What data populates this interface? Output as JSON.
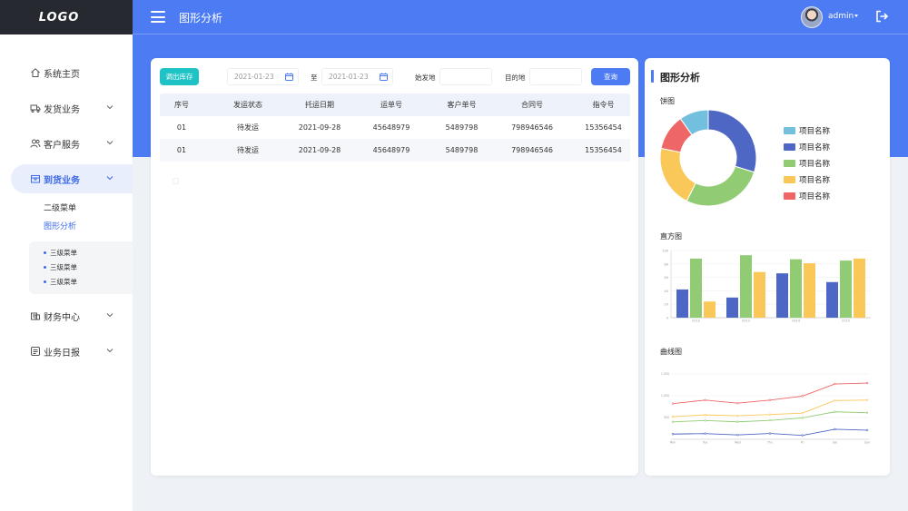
{
  "sidebar": {
    "logo": "LOGO",
    "items": [
      {
        "label": "系统主页",
        "icon": "home-icon"
      },
      {
        "label": "发货业务",
        "icon": "truck-icon"
      },
      {
        "label": "客户服务",
        "icon": "users-icon"
      },
      {
        "label": "到货业务",
        "icon": "box-icon"
      },
      {
        "label": "财务中心",
        "icon": "finance-icon"
      },
      {
        "label": "业务日报",
        "icon": "report-icon"
      }
    ],
    "submenu": [
      "二级菜单",
      "图形分析"
    ],
    "submenu2": [
      "三级菜单",
      "三级菜单",
      "三级菜单"
    ]
  },
  "header": {
    "title": "图形分析",
    "username": "admin"
  },
  "filter": {
    "export_label": "调出库存",
    "date_start": "2021-01-23",
    "date_sep": "至",
    "date_end": "2021-01-23",
    "origin_label": "始发地",
    "dest_label": "目的地",
    "query_label": "查询"
  },
  "table": {
    "columns": [
      "序号",
      "发运状态",
      "托运日期",
      "运单号",
      "客户单号",
      "合同号",
      "指令号"
    ],
    "rows": [
      [
        "01",
        "待发运",
        "2021-09-28",
        "45648979",
        "5489798",
        "798946546",
        "15356454"
      ],
      [
        "01",
        "待发运",
        "2021-09-28",
        "45648979",
        "5489798",
        "798946546",
        "15356454"
      ]
    ]
  },
  "analysis": {
    "title": "图形分析",
    "pie_title": "饼图",
    "bar_title": "直方图",
    "line_title": "曲线图"
  },
  "colors": {
    "accent": "#4c7bf3",
    "teal": "#1fc3c6"
  },
  "chart_data": [
    {
      "type": "pie",
      "title": "饼图",
      "categories": [
        "项目名称",
        "项目名称",
        "项目名称",
        "项目名称",
        "项目名称"
      ],
      "values": [
        335,
        310,
        234,
        135,
        110
      ],
      "colors": [
        "#4e66c4",
        "#91cc75",
        "#fac858",
        "#ee6666",
        "#73c0de"
      ],
      "legend_order": [
        4,
        0,
        1,
        2,
        3
      ],
      "donut": true,
      "legend": "right"
    },
    {
      "type": "bar",
      "title": "直方图",
      "categories": [
        "2012",
        "2013",
        "2014",
        "2015"
      ],
      "ylim": [
        0,
        100
      ],
      "yticks": [
        "100",
        "80",
        "60",
        "40",
        "20",
        "0"
      ],
      "series": [
        {
          "values": [
            42,
            30,
            66,
            53
          ],
          "color": "#4e66c4"
        },
        {
          "values": [
            88,
            93,
            87,
            85
          ],
          "color": "#91cc75"
        },
        {
          "values": [
            24,
            68,
            81,
            88
          ],
          "color": "#fac858"
        }
      ]
    },
    {
      "type": "line",
      "title": "曲线图",
      "categories": [
        "Mon",
        "Tue",
        "Wed",
        "Thu",
        "Fri",
        "Sat",
        "Sun"
      ],
      "ylim": [
        0,
        1500
      ],
      "yticks": [
        "1,500",
        "1,000",
        "500"
      ],
      "series": [
        {
          "values": [
            120,
            132,
            101,
            134,
            90,
            230,
            210
          ],
          "color": "#4e66c4"
        },
        {
          "values": [
            400,
            432,
            401,
            434,
            490,
            630,
            610
          ],
          "color": "#91cc75"
        },
        {
          "values": [
            520,
            560,
            540,
            570,
            600,
            890,
            900
          ],
          "color": "#fac858"
        },
        {
          "values": [
            820,
            900,
            830,
            900,
            990,
            1270,
            1290
          ],
          "color": "#ee6666"
        }
      ]
    }
  ]
}
